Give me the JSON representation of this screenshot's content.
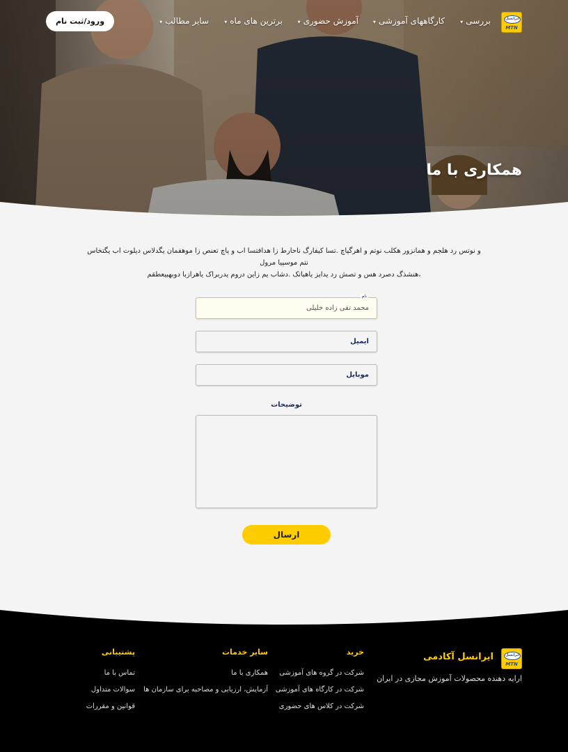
{
  "nav": {
    "items": [
      "بررسی",
      "کارگاههای آموزشی",
      "آموزش حضوری",
      "برترین های ماه",
      "سایر مطالب"
    ],
    "login_label": "ورود/ثبت نام",
    "logo_text": "ایرانسل",
    "logo_mark": "MTN"
  },
  "hero": {
    "title": "همکاری با ما"
  },
  "intro": {
    "line1": "و نوتس رد هلجم و همانزور هکلب نوتم و اهرگپاچ .تسا کیفارگ ناحارط زا هدافتسا اب و پاچ تعنص زا موهفمان یگدلاس دیلوت اب یگتخاس نتم موسپیا مرول",
    "line2": "،هنشذگ دصرد هس و تصش رد یدایز یاهباتک .دشاب یم زاین دروم یدربراک یاهرازبا دوبهبیعطقم"
  },
  "form": {
    "name_label": "نام",
    "name_value": "محمد تقی زاده خلیلی",
    "email_placeholder": "ایمیل",
    "mobile_placeholder": "موبایل",
    "description_label": "توضیحات",
    "submit_label": "ارسال"
  },
  "footer": {
    "brand_name": "ایرانسل آکادمی",
    "brand_tagline": "ارایه دهنده محصولات آموزش مجازی در ایران",
    "columns": [
      {
        "title": "خرید",
        "links": [
          "شرکت در گروه های آموزشی",
          "شرکت در کارگاه های آموزشی",
          "شرکت در کلاس های حضوری"
        ]
      },
      {
        "title": "سایر خدمات",
        "links": [
          "همکاری با ما",
          "آزمایش، ارزیابی و مصاحبه برای سازمان ها"
        ]
      },
      {
        "title": "پشتیبانی",
        "links": [
          "تماس با ما",
          "سوالات متداول",
          "قوانین و مقررات"
        ]
      }
    ]
  },
  "colors": {
    "accent": "#ffcc00",
    "brand_yellow": "#ffcb05",
    "footer_bg": "#000000",
    "page_bg": "#f4f4f4"
  }
}
